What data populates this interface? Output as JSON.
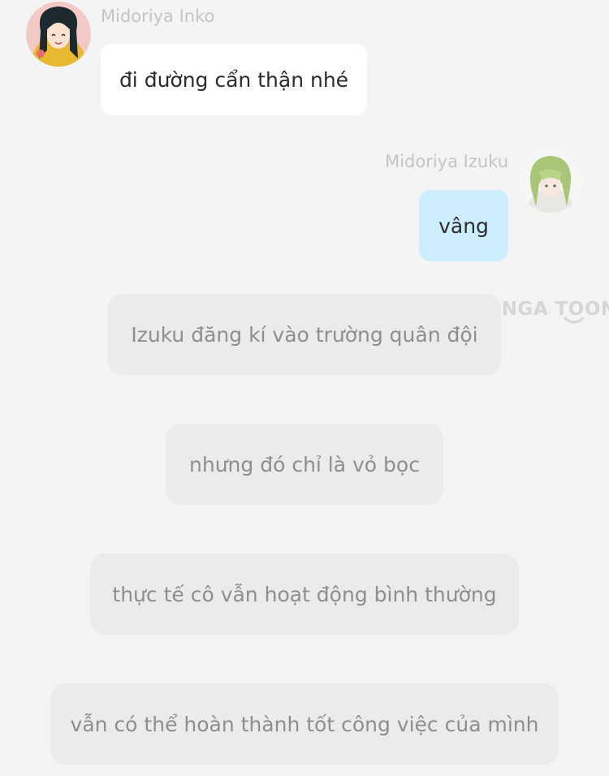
{
  "messages": [
    {
      "type": "left",
      "sender": "Midoriya Inko",
      "text": "đi đường cẩn thận nhé",
      "avatar_icon": "avatar-anime-dark-hair-icon"
    },
    {
      "type": "right",
      "sender": "Midoriya Izuku",
      "text": "vâng",
      "avatar_icon": "avatar-anime-green-hair-icon"
    },
    {
      "type": "narration",
      "text": "Izuku đăng kí vào trường quân đội"
    },
    {
      "type": "narration",
      "text": "nhưng đó chỉ là vỏ bọc"
    },
    {
      "type": "narration",
      "text": "thực tế cô vẫn hoạt động bình thường"
    },
    {
      "type": "narration",
      "text": "vẫn có thể hoàn thành tốt công việc của mình"
    }
  ],
  "watermark": {
    "text": "MANGA TOON"
  },
  "colors": {
    "background": "#f4f4f4",
    "left_bubble": "#ffffff",
    "right_bubble": "#cdeeff",
    "narration_bubble": "#ebebeb",
    "narration_text": "#8e8e8e",
    "sender_name": "#c4c4c4"
  }
}
